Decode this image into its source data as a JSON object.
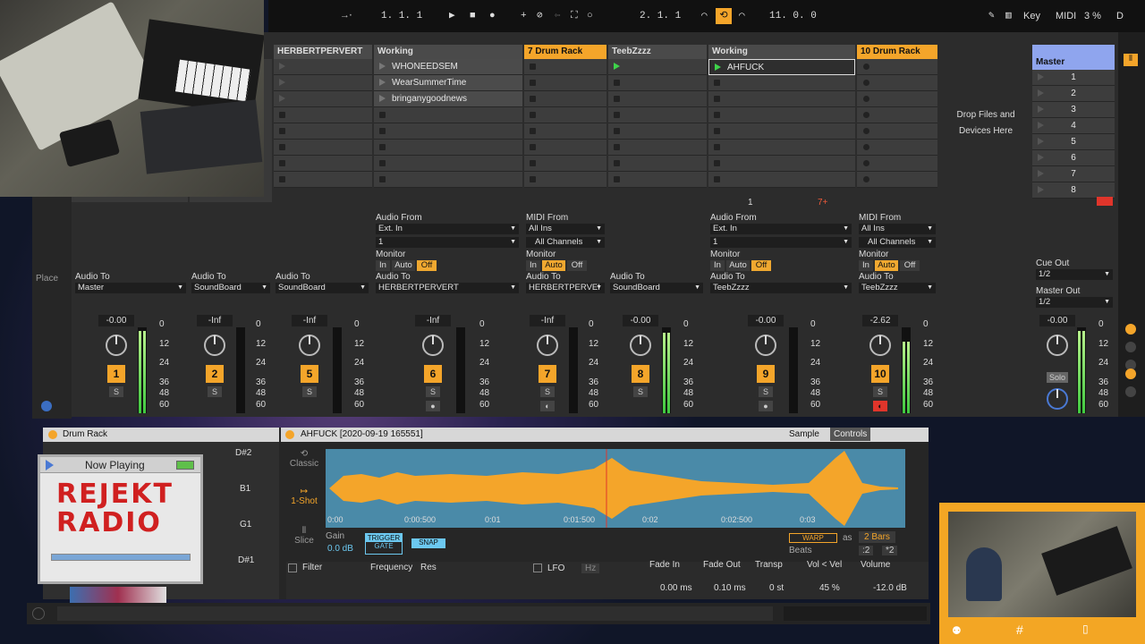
{
  "transport": {
    "position": "1.   1.   1",
    "loop_start": "2.   1.   1",
    "loop_len": "11.   0.   0",
    "key_label": "Key",
    "midi_label": "MIDI",
    "cpu": "3 %",
    "d_label": "D"
  },
  "tracks": [
    {
      "name": "",
      "color": "#f4a52a",
      "num": "1",
      "vol": "-0.00",
      "audio_to": "Master",
      "clips": []
    },
    {
      "name": "",
      "color": "#f4a52a",
      "num": "2",
      "vol": "-Inf",
      "audio_to": "SoundBoard",
      "clips": []
    },
    {
      "name": "HERBERTPERVERT",
      "color": "#4a4a4a",
      "num": "5",
      "vol": "-Inf",
      "audio_to": "SoundBoard",
      "clips": []
    },
    {
      "name": "Working",
      "color": "#4a4a4a",
      "num": "6",
      "vol": "-Inf",
      "audio_from": "Ext. In",
      "input_ch": "1",
      "audio_to": "HERBERTPERVERT",
      "clips": [
        "WHONEEDSEM",
        "WearSummerTime",
        "bringanygoodnews"
      ]
    },
    {
      "name": "7 Drum Rack",
      "color": "#f4a52a",
      "num": "7",
      "vol": "-Inf",
      "midi_from": "All Ins",
      "input_ch": "All Channels",
      "audio_to": "HERBERTPERVEI",
      "clips": []
    },
    {
      "name": "TeebZzzz",
      "color": "#4a4a4a",
      "num": "8",
      "vol": "-0.00",
      "audio_to": "SoundBoard",
      "clips": []
    },
    {
      "name": "Working",
      "color": "#4a4a4a",
      "num": "9",
      "vol": "-0.00",
      "audio_from": "Ext. In",
      "input_ch": "1",
      "audio_to": "TeebZzzz",
      "clips": [
        "AHFUCK"
      ]
    },
    {
      "name": "10 Drum Rack",
      "color": "#f4a52a",
      "num": "10",
      "vol": "-2.62",
      "midi_from": "All Ins",
      "input_ch": "All Channels",
      "audio_to": "TeebZzzz",
      "clips": []
    }
  ],
  "labels": {
    "audio_from": "Audio From",
    "midi_from": "MIDI From",
    "monitor": "Monitor",
    "mon_in": "In",
    "mon_auto": "Auto",
    "mon_off": "Off",
    "audio_to": "Audio To",
    "solo": "S",
    "drop_hint_1": "Drop Files and",
    "drop_hint_2": "Devices Here",
    "slot_count_a": "1",
    "slot_count_b": "7+"
  },
  "scale": [
    "0",
    "12",
    "24",
    "36",
    "48",
    "60"
  ],
  "master": {
    "name": "Master",
    "scenes": [
      "1",
      "2",
      "3",
      "4",
      "5",
      "6",
      "7",
      "8"
    ],
    "cue_out_label": "Cue Out",
    "cue_out": "1/2",
    "master_out_label": "Master Out",
    "master_out": "1/2",
    "vol": "-0.00",
    "solo": "Solo"
  },
  "browser": {
    "places": "Place"
  },
  "drumrack": {
    "title": "Drum Rack",
    "pads": [
      "D#2",
      "B1",
      "G1",
      "D#1"
    ]
  },
  "clip": {
    "title": "AHFUCK [2020-09-19 165551]",
    "tab_sample": "Sample",
    "tab_controls": "Controls",
    "mode_classic": "Classic",
    "mode_oneshot": "1-Shot",
    "mode_slice": "Slice",
    "gain_label": "Gain",
    "gain": "0.0 dB",
    "trigger": "TRIGGER",
    "gate": "GATE",
    "snap": "SNAP",
    "warp": "WARP",
    "as": "as",
    "bars": "2 Bars",
    "beats": "Beats",
    "div2": ":2",
    "mul2": "*2",
    "timeline": [
      "0:00",
      "0:00:500",
      "0:01",
      "0:01:500",
      "0:02",
      "0:02:500",
      "0:03"
    ],
    "filter": "Filter",
    "frequency": "Frequency",
    "res": "Res",
    "lfo": "LFO",
    "hz": "Hz",
    "fade_in_label": "Fade In",
    "fade_in": "0.00 ms",
    "fade_out_label": "Fade Out",
    "fade_out": "0.10 ms",
    "transp_label": "Transp",
    "transp": "0 st",
    "velvol_label": "Vol < Vel",
    "velvol": "45 %",
    "volume_label": "Volume",
    "volume": "-12.0 dB"
  },
  "radio": {
    "now_playing": "Now Playing",
    "logo": "REJEKT RADIO"
  }
}
